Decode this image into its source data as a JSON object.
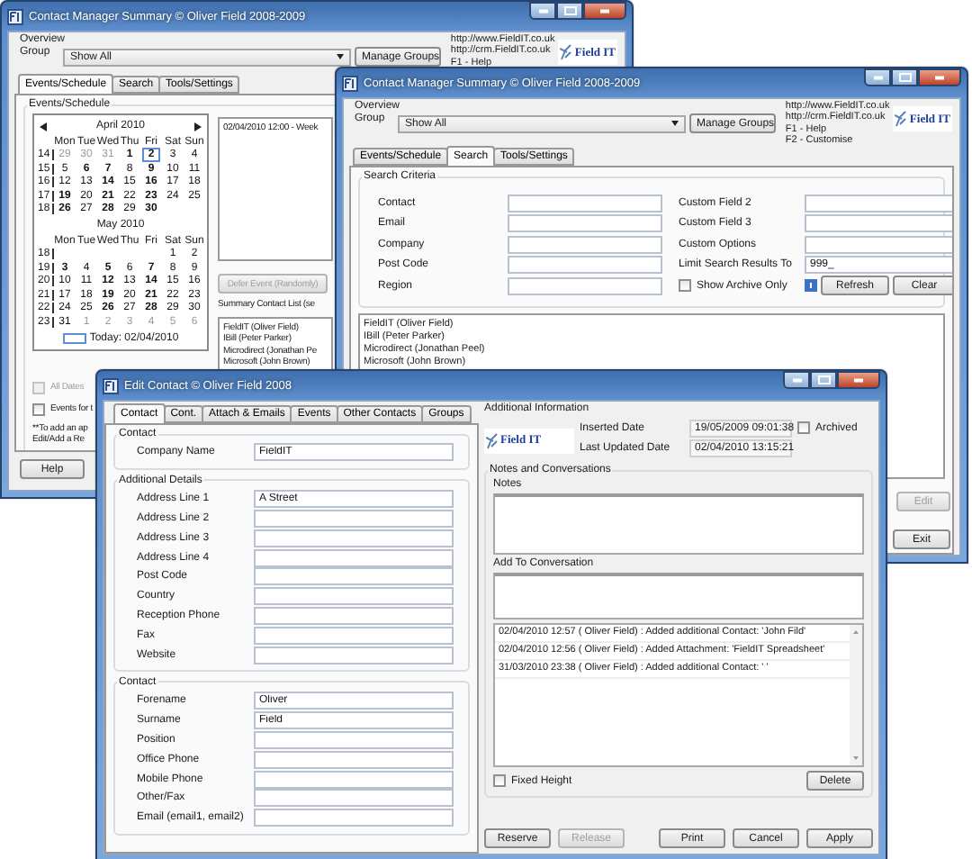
{
  "schedule_window": {
    "title": "Contact Manager Summary © Oliver Field 2008-2009",
    "overview_label": "Overview",
    "group_label": "Group",
    "group_value": "Show All",
    "manage_groups_button": "Manage Groups",
    "info_lines": [
      "http://www.FieldIT.co.uk",
      "http://crm.FieldIT.co.uk",
      "F1 - Help"
    ],
    "logo_text": "Field IT",
    "tabs": [
      {
        "label": "Events/Schedule",
        "selected": true
      },
      {
        "label": "Search",
        "selected": false
      },
      {
        "label": "Tools/Settings",
        "selected": false
      }
    ],
    "group_title": "Events/Schedule",
    "calendars": [
      {
        "month": "April 2010",
        "navigation": true,
        "weekdays": [
          "Mon",
          "Tue",
          "Wed",
          "Thu",
          "Fri",
          "Sat",
          "Sun"
        ],
        "weeks": [
          {
            "week": "14",
            "days": [
              {
                "d": "29",
                "event": false,
                "other_month": true,
                "selected": false
              },
              {
                "d": "30",
                "event": false,
                "other_month": true,
                "selected": false
              },
              {
                "d": "31",
                "event": false,
                "other_month": true,
                "selected": false
              },
              {
                "d": "1",
                "event": true,
                "other_month": false,
                "selected": false
              },
              {
                "d": "2",
                "event": true,
                "other_month": false,
                "selected": true
              },
              {
                "d": "3",
                "event": false,
                "other_month": false,
                "selected": false
              },
              {
                "d": "4",
                "event": false,
                "other_month": false,
                "selected": false
              }
            ]
          },
          {
            "week": "15",
            "days": [
              {
                "d": "5",
                "event": false,
                "other_month": false,
                "selected": false
              },
              {
                "d": "6",
                "event": true,
                "other_month": false,
                "selected": false
              },
              {
                "d": "7",
                "event": true,
                "other_month": false,
                "selected": false
              },
              {
                "d": "8",
                "event": false,
                "other_month": false,
                "selected": false
              },
              {
                "d": "9",
                "event": true,
                "other_month": false,
                "selected": false
              },
              {
                "d": "10",
                "event": false,
                "other_month": false,
                "selected": false
              },
              {
                "d": "11",
                "event": false,
                "other_month": false,
                "selected": false
              }
            ]
          },
          {
            "week": "16",
            "days": [
              {
                "d": "12",
                "event": false,
                "other_month": false,
                "selected": false
              },
              {
                "d": "13",
                "event": false,
                "other_month": false,
                "selected": false
              },
              {
                "d": "14",
                "event": true,
                "other_month": false,
                "selected": false
              },
              {
                "d": "15",
                "event": false,
                "other_month": false,
                "selected": false
              },
              {
                "d": "16",
                "event": true,
                "other_month": false,
                "selected": false
              },
              {
                "d": "17",
                "event": false,
                "other_month": false,
                "selected": false
              },
              {
                "d": "18",
                "event": false,
                "other_month": false,
                "selected": false
              }
            ]
          },
          {
            "week": "17",
            "days": [
              {
                "d": "19",
                "event": true,
                "other_month": false,
                "selected": false
              },
              {
                "d": "20",
                "event": false,
                "other_month": false,
                "selected": false
              },
              {
                "d": "21",
                "event": true,
                "other_month": false,
                "selected": false
              },
              {
                "d": "22",
                "event": false,
                "other_month": false,
                "selected": false
              },
              {
                "d": "23",
                "event": true,
                "other_month": false,
                "selected": false
              },
              {
                "d": "24",
                "event": false,
                "other_month": false,
                "selected": false
              },
              {
                "d": "25",
                "event": false,
                "other_month": false,
                "selected": false
              }
            ]
          },
          {
            "week": "18",
            "days": [
              {
                "d": "26",
                "event": true,
                "other_month": false,
                "selected": false
              },
              {
                "d": "27",
                "event": false,
                "other_month": false,
                "selected": false
              },
              {
                "d": "28",
                "event": true,
                "other_month": false,
                "selected": false
              },
              {
                "d": "29",
                "event": false,
                "other_month": false,
                "selected": false
              },
              {
                "d": "30",
                "event": true,
                "other_month": false,
                "selected": false
              }
            ]
          }
        ]
      },
      {
        "month": "May 2010",
        "navigation": false,
        "weekdays": [
          "Mon",
          "Tue",
          "Wed",
          "Thu",
          "Fri",
          "Sat",
          "Sun"
        ],
        "weeks": [
          {
            "week": "18",
            "days": [
              {
                "d": "1",
                "event": false,
                "other_month": false,
                "selected": false
              },
              {
                "d": "2",
                "event": false,
                "other_month": false,
                "selected": false
              }
            ]
          },
          {
            "week": "19",
            "days": [
              {
                "d": "3",
                "event": true,
                "other_month": false,
                "selected": false
              },
              {
                "d": "4",
                "event": false,
                "other_month": false,
                "selected": false
              },
              {
                "d": "5",
                "event": true,
                "other_month": false,
                "selected": false
              },
              {
                "d": "6",
                "event": false,
                "other_month": false,
                "selected": false
              },
              {
                "d": "7",
                "event": true,
                "other_month": false,
                "selected": false
              },
              {
                "d": "8",
                "event": false,
                "other_month": false,
                "selected": false
              },
              {
                "d": "9",
                "event": false,
                "other_month": false,
                "selected": false
              }
            ]
          },
          {
            "week": "20",
            "days": [
              {
                "d": "10",
                "event": false,
                "other_month": false,
                "selected": false
              },
              {
                "d": "11",
                "event": false,
                "other_month": false,
                "selected": false
              },
              {
                "d": "12",
                "event": true,
                "other_month": false,
                "selected": false
              },
              {
                "d": "13",
                "event": false,
                "other_month": false,
                "selected": false
              },
              {
                "d": "14",
                "event": true,
                "other_month": false,
                "selected": false
              },
              {
                "d": "15",
                "event": false,
                "other_month": false,
                "selected": false
              },
              {
                "d": "16",
                "event": false,
                "other_month": false,
                "selected": false
              }
            ]
          },
          {
            "week": "21",
            "days": [
              {
                "d": "17",
                "event": false,
                "other_month": false,
                "selected": false
              },
              {
                "d": "18",
                "event": false,
                "other_month": false,
                "selected": false
              },
              {
                "d": "19",
                "event": true,
                "other_month": false,
                "selected": false
              },
              {
                "d": "20",
                "event": false,
                "other_month": false,
                "selected": false
              },
              {
                "d": "21",
                "event": true,
                "other_month": false,
                "selected": false
              },
              {
                "d": "22",
                "event": false,
                "other_month": false,
                "selected": false
              },
              {
                "d": "23",
                "event": false,
                "other_month": false,
                "selected": false
              }
            ]
          },
          {
            "week": "22",
            "days": [
              {
                "d": "24",
                "event": false,
                "other_month": false,
                "selected": false
              },
              {
                "d": "25",
                "event": false,
                "other_month": false,
                "selected": false
              },
              {
                "d": "26",
                "event": true,
                "other_month": false,
                "selected": false
              },
              {
                "d": "27",
                "event": false,
                "other_month": false,
                "selected": false
              },
              {
                "d": "28",
                "event": true,
                "other_month": false,
                "selected": false
              },
              {
                "d": "29",
                "event": false,
                "other_month": false,
                "selected": false
              },
              {
                "d": "30",
                "event": false,
                "other_month": false,
                "selected": false
              }
            ]
          },
          {
            "week": "23",
            "days": [
              {
                "d": "31",
                "event": false,
                "other_month": false,
                "selected": false
              },
              {
                "d": "1",
                "event": false,
                "other_month": true,
                "selected": false
              },
              {
                "d": "2",
                "event": false,
                "other_month": true,
                "selected": false
              },
              {
                "d": "3",
                "event": false,
                "other_month": true,
                "selected": false
              },
              {
                "d": "4",
                "event": false,
                "other_month": true,
                "selected": false
              },
              {
                "d": "5",
                "event": false,
                "other_month": true,
                "selected": false
              },
              {
                "d": "6",
                "event": false,
                "other_month": true,
                "selected": false
              }
            ]
          }
        ]
      }
    ],
    "today": "Today: 02/04/2010",
    "events": [
      "02/04/2010 12:00 - Week"
    ],
    "defer_button": {
      "label": "Defer Event (Randomly)",
      "disabled": true
    },
    "summary_label": "Summary Contact List (se",
    "contacts": [
      "FieldIT (Oliver Field)",
      "IBill (Peter Parker)",
      "Microdirect (Jonathan Pe",
      "Microsoft (John Brown)"
    ],
    "options": [
      {
        "label": "All Dates",
        "checked": false,
        "disabled": true
      },
      {
        "label": "Events for t",
        "checked": false,
        "disabled": false
      }
    ],
    "notes": [
      "**To add an ap",
      "Edit/Add a Re"
    ],
    "help_button": "Help"
  },
  "search_window": {
    "title": "Contact Manager Summary © Oliver Field 2008-2009",
    "overview_label": "Overview",
    "group_label": "Group",
    "group_value": "Show All",
    "manage_groups_button": "Manage Groups",
    "info_lines": [
      "http://www.FieldIT.co.uk",
      "http://crm.FieldIT.co.uk",
      "F1 - Help",
      "F2 - Customise"
    ],
    "logo_text": "Field IT",
    "tabs": [
      {
        "label": "Events/Schedule",
        "selected": false
      },
      {
        "label": "Search",
        "selected": true
      },
      {
        "label": "Tools/Settings",
        "selected": false
      }
    ],
    "group_title": "Search Criteria",
    "left_fields": [
      {
        "label": "Contact"
      },
      {
        "label": "Email"
      },
      {
        "label": "Company"
      },
      {
        "label": "Post Code"
      },
      {
        "label": "Region"
      }
    ],
    "right_fields": [
      {
        "label": "Custom Field 2"
      },
      {
        "label": "Custom Field 3"
      },
      {
        "label": "Custom Options"
      },
      {
        "label": "Limit Search Results To",
        "value": "999_"
      }
    ],
    "show_archive": {
      "label": "Show Archive Only",
      "checked": false
    },
    "refresh_button": "Refresh",
    "clear_button": "Clear",
    "results": [
      "FieldIT (Oliver Field)",
      "IBill (Peter Parker)",
      "Microdirect (Jonathan Peel)",
      "Microsoft (John Brown)"
    ],
    "edit_button": {
      "label": "Edit",
      "disabled": true
    },
    "exit_button": "Exit"
  },
  "edit_window": {
    "title": "Edit Contact  © Oliver Field 2008",
    "tabs": [
      {
        "label": "Contact",
        "selected": true
      },
      {
        "label": "Cont.",
        "selected": false
      },
      {
        "label": "Attach & Emails",
        "selected": false
      },
      {
        "label": "Events",
        "selected": false
      },
      {
        "label": "Other Contacts",
        "selected": false
      },
      {
        "label": "Groups",
        "selected": false
      }
    ],
    "sections": [
      {
        "title": "Contact",
        "fields": [
          {
            "label": "Company Name",
            "value": "FieldIT"
          }
        ]
      },
      {
        "title": "Additional Details",
        "fields": [
          {
            "label": "Address Line 1",
            "value": "A Street"
          },
          {
            "label": "Address Line 2"
          },
          {
            "label": "Address Line 3"
          },
          {
            "label": "Address Line 4"
          },
          {
            "label": "Post Code"
          },
          {
            "label": "Country"
          },
          {
            "label": "Reception Phone"
          },
          {
            "label": "Fax"
          },
          {
            "label": "Website"
          }
        ]
      },
      {
        "title": "Contact",
        "fields": [
          {
            "label": "Forename",
            "value": "Oliver"
          },
          {
            "label": "Surname",
            "value": "Field"
          },
          {
            "label": "Position"
          },
          {
            "label": "Office Phone"
          },
          {
            "label": "Mobile Phone"
          },
          {
            "label": "Other/Fax"
          },
          {
            "label": "Email (email1, email2)"
          }
        ]
      }
    ],
    "info_title": "Additional Information",
    "logo_text": "Field IT",
    "inserted_label": "Inserted Date",
    "inserted_value": "19/05/2009 09:01:38",
    "archived": {
      "label": "Archived",
      "checked": false
    },
    "updated_label": "Last Updated Date",
    "updated_value": "02/04/2010 13:15:21",
    "notes_group_title": "Notes and Conversations",
    "notes_label": "Notes",
    "add_label": "Add To Conversation",
    "conversation": [
      "02/04/2010 12:57 ( Oliver Field) : Added additional Contact: 'John Fild'",
      "02/04/2010 12:56 ( Oliver Field) : Added Attachment: 'FieldIT Spreadsheet'",
      "31/03/2010 23:38 ( Oliver Field) : Added additional Contact: ' '"
    ],
    "fixed_height": {
      "label": "Fixed Height",
      "checked": false
    },
    "delete_button": "Delete",
    "buttons": [
      {
        "label": "Reserve",
        "disabled": false
      },
      {
        "label": "Release",
        "disabled": true
      },
      {
        "label": "Print",
        "disabled": false
      },
      {
        "label": "Cancel",
        "disabled": false
      },
      {
        "label": "Apply",
        "disabled": false
      }
    ]
  }
}
